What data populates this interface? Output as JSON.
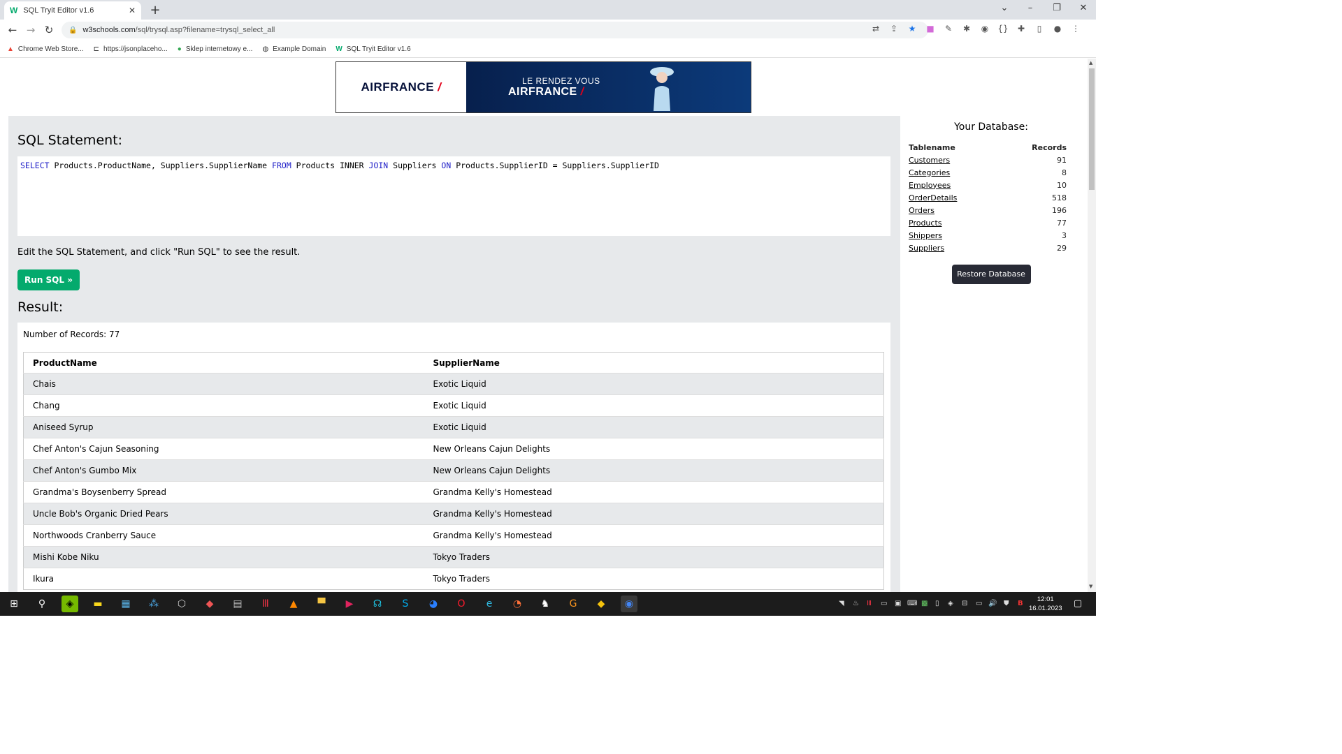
{
  "browser": {
    "tab_title": "SQL Tryit Editor v1.6",
    "tab_favicon": "W",
    "new_tab": "+",
    "url_host": "w3schools.com",
    "url_path": "/sql/trysql.asp?filename=trysql_select_all",
    "bookmarks": [
      {
        "label": "Chrome Web Store...",
        "icon": "store-icon"
      },
      {
        "label": "https://jsonplaceho...",
        "icon": "api-icon"
      },
      {
        "label": "Sklep internetowy e...",
        "icon": "shield-icon"
      },
      {
        "label": "Example Domain",
        "icon": "globe-icon"
      },
      {
        "label": "SQL Tryit Editor v1.6",
        "icon": "w3schools-icon"
      }
    ]
  },
  "ad": {
    "brand": "AIRFRANCE",
    "tagline": "LE RENDEZ VOUS",
    "brand2": "AIRFRANCE"
  },
  "editor": {
    "heading": "SQL Statement:",
    "sql": [
      {
        "t": "SELECT",
        "kw": true
      },
      {
        "t": " Products.ProductName, Suppliers.SupplierName ",
        "kw": false
      },
      {
        "t": "FROM",
        "kw": true
      },
      {
        "t": " Products INNER ",
        "kw": false
      },
      {
        "t": "JOIN",
        "kw": true
      },
      {
        "t": " Suppliers ",
        "kw": false
      },
      {
        "t": "ON",
        "kw": true
      },
      {
        "t": " Products.SupplierID = Suppliers.SupplierID",
        "kw": false
      }
    ],
    "hint": "Edit the SQL Statement, and click \"Run SQL\" to see the result.",
    "run_label": "Run SQL »"
  },
  "result": {
    "heading": "Result:",
    "count_text": "Number of Records: 77",
    "columns": [
      "ProductName",
      "SupplierName"
    ],
    "rows": [
      [
        "Chais",
        "Exotic Liquid"
      ],
      [
        "Chang",
        "Exotic Liquid"
      ],
      [
        "Aniseed Syrup",
        "Exotic Liquid"
      ],
      [
        "Chef Anton's Cajun Seasoning",
        "New Orleans Cajun Delights"
      ],
      [
        "Chef Anton's Gumbo Mix",
        "New Orleans Cajun Delights"
      ],
      [
        "Grandma's Boysenberry Spread",
        "Grandma Kelly's Homestead"
      ],
      [
        "Uncle Bob's Organic Dried Pears",
        "Grandma Kelly's Homestead"
      ],
      [
        "Northwoods Cranberry Sauce",
        "Grandma Kelly's Homestead"
      ],
      [
        "Mishi Kobe Niku",
        "Tokyo Traders"
      ],
      [
        "Ikura",
        "Tokyo Traders"
      ]
    ]
  },
  "database": {
    "title": "Your Database:",
    "col_name": "Tablename",
    "col_records": "Records",
    "tables": [
      {
        "name": "Customers",
        "records": "91"
      },
      {
        "name": "Categories",
        "records": "8"
      },
      {
        "name": "Employees",
        "records": "10"
      },
      {
        "name": "OrderDetails",
        "records": "518"
      },
      {
        "name": "Orders",
        "records": "196"
      },
      {
        "name": "Products",
        "records": "77"
      },
      {
        "name": "Shippers",
        "records": "3"
      },
      {
        "name": "Suppliers",
        "records": "29"
      }
    ],
    "restore_label": "Restore Database"
  },
  "taskbar": {
    "time": "12:01",
    "date": "16.01.2023"
  },
  "colors": {
    "accent_green": "#04aa6d",
    "panel_gray": "#e7e9eb",
    "dark_button": "#282a35",
    "sql_keyword": "#2020c8"
  }
}
